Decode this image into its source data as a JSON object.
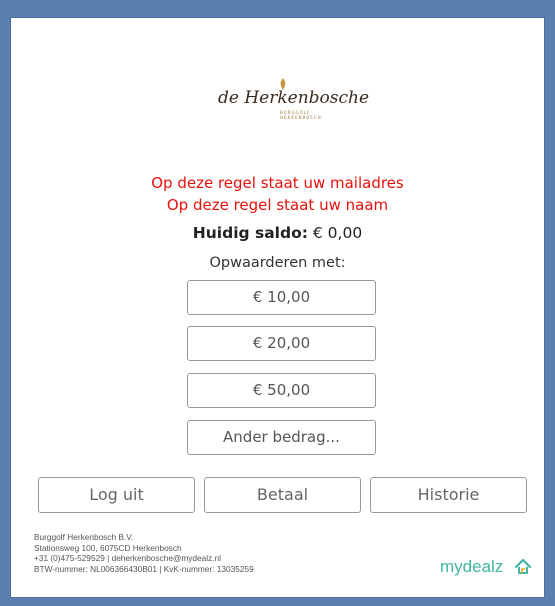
{
  "logo": {
    "text": "de Herkenbosche",
    "tagline": "BURGGOLF HERKENBOSCH"
  },
  "user": {
    "email_line": "Op deze regel staat uw mailadres",
    "name_line": "Op deze regel staat uw naam"
  },
  "balance": {
    "label": "Huidig saldo:",
    "value": "€ 0,00"
  },
  "topup": {
    "heading": "Opwaarderen met:",
    "options": [
      "€ 10,00",
      "€ 20,00",
      "€ 50,00",
      "Ander bedrag..."
    ]
  },
  "actions": {
    "logout": "Log uit",
    "pay": "Betaal",
    "history": "Historie"
  },
  "footer": {
    "company": "Burggolf Herkenbosch B.V.",
    "address": "Stationsweg 100, 6075CD Herkenbosch",
    "contact": "+31 (0)475-529529 | deherkenbosche@mydealz.nl",
    "registration": "BTW-nummer: NL006366430B01 | KvK-nummer: 13035259"
  },
  "brand": {
    "name": "mydealz",
    "color": "#3fb5a2"
  },
  "colors": {
    "accent_red": "#e8100a",
    "frame": "#4a6d9e"
  }
}
